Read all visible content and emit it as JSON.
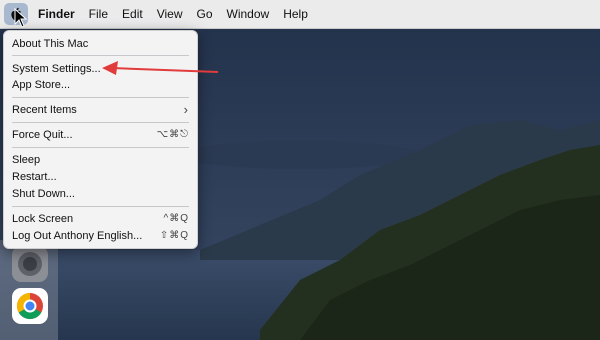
{
  "menubar": {
    "app_name": "Finder",
    "items": [
      "File",
      "Edit",
      "View",
      "Go",
      "Window",
      "Help"
    ]
  },
  "apple_menu": {
    "items": [
      {
        "label": "About This Mac",
        "shortcut": ""
      },
      {
        "label": "System Settings...",
        "shortcut": ""
      },
      {
        "label": "App Store...",
        "shortcut": ""
      },
      {
        "label": "Recent Items",
        "shortcut": "›"
      },
      {
        "label": "Force Quit...",
        "shortcut": "⌥⌘⎋"
      },
      {
        "label": "Sleep",
        "shortcut": ""
      },
      {
        "label": "Restart...",
        "shortcut": ""
      },
      {
        "label": "Shut Down...",
        "shortcut": ""
      },
      {
        "label": "Lock Screen",
        "shortcut": "^⌘Q"
      },
      {
        "label": "Log Out Anthony English...",
        "shortcut": "⇧⌘Q"
      }
    ]
  },
  "colors": {
    "annotation_arrow": "#e23b3b",
    "menubar_bg": "#ebebec"
  }
}
